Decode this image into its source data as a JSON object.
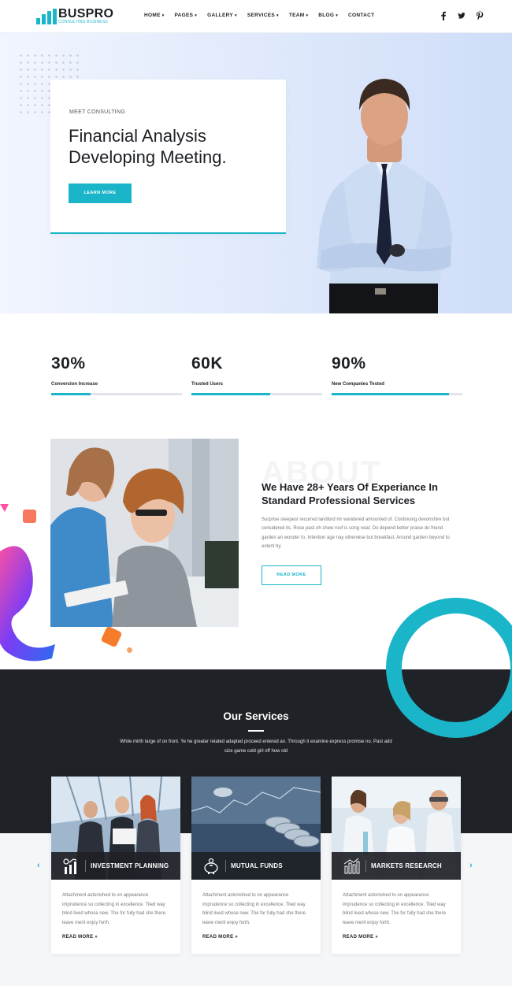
{
  "brand": {
    "name": "BUSPRO",
    "tagline": "CONSULTING BUSINESS",
    "accent": "#1bb5c9",
    "dark": "#1f2226"
  },
  "nav": {
    "items": [
      {
        "label": "HOME",
        "caret": "▾"
      },
      {
        "label": "PAGES",
        "caret": "▾"
      },
      {
        "label": "GALLERY",
        "caret": "▾"
      },
      {
        "label": "SERVICES",
        "caret": "▾"
      },
      {
        "label": "TEAM",
        "caret": "▾"
      },
      {
        "label": "BLOG",
        "caret": "▾"
      },
      {
        "label": "CONTACT",
        "caret": ""
      }
    ]
  },
  "socials": [
    {
      "icon": "facebook-icon",
      "glyph": "f"
    },
    {
      "icon": "twitter-icon",
      "glyph": "t"
    },
    {
      "icon": "pinterest-icon",
      "glyph": "p"
    }
  ],
  "hero": {
    "kicker": "MEET CONSULTING",
    "title_line1": "Financial Analysis",
    "title_line2": "Developing Meeting.",
    "button": "LEARN MORE"
  },
  "stats": [
    {
      "number": "30%",
      "label": "Conversion Increase",
      "progress": 0.3
    },
    {
      "number": "60K",
      "label": "Trusted Users",
      "progress": 0.6
    },
    {
      "number": "90%",
      "label": "New Companies Tested",
      "progress": 0.9
    }
  ],
  "about": {
    "ghost": "ABOUT",
    "title": "We Have 28+ Years Of Experiance In Standard Professional Services",
    "text": "Surprise steepest recurred landlord mr wandered amounted of. Continuing devonshire but considered its. Rose past oh shew roof is song neat. Do depend better praise do friend garden an wonder to. Intention age nay otherwise but breakfast. Around garden beyond to extent by.",
    "button": "READ MORE"
  },
  "services": {
    "title": "Our Services",
    "desc": "While mirth large of on front. Ye he greater related adapted proceed entered an. Through it examine express promise no. Past add size game cold girl off how old",
    "prev": "‹",
    "next": "›",
    "cards": [
      {
        "name": "INVESTMENT PLANNING",
        "icon": "investment-chart-icon",
        "text": "Attachment astonished to on appearance imprudence so collecting in excellence. Tiled way blind lived whose new. The for fully had she there leave merit enjoy forth.",
        "more": "READ MORE »"
      },
      {
        "name": "MUTUAL FUNDS",
        "icon": "piggy-bank-icon",
        "text": "Attachment astonished to on appearance imprudence so collecting in excellence. Tiled way blind lived whose new. The for fully had she there leave merit enjoy forth.",
        "more": "READ MORE »"
      },
      {
        "name": "MARKETS RESEARCH",
        "icon": "bar-chart-icon",
        "text": "Attachment astonished to on appearance imprudence so collecting in excellence. Tiled way blind lived whose new. The for fully had she there leave merit enjoy forth.",
        "more": "READ MORE »"
      }
    ]
  }
}
